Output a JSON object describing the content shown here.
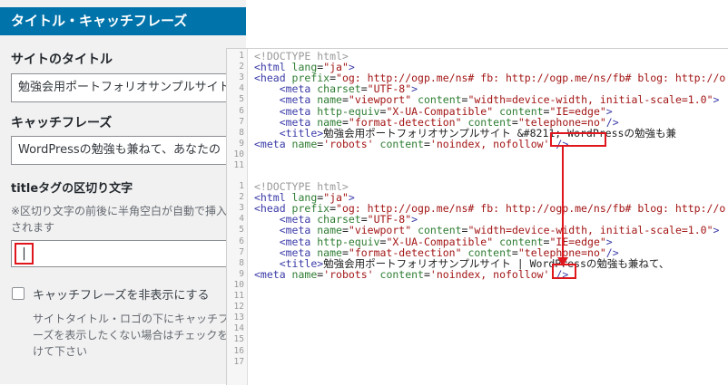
{
  "panel": {
    "header": "タイトル・キャッチフレーズ",
    "site_title_label": "サイトのタイトル",
    "site_title_value": "勉強会用ポートフォリオサンプルサイト",
    "catchphrase_label": "キャッチフレーズ",
    "catchphrase_value": "WordPressの勉強も兼ねて、あなたの",
    "separator_label": "titleタグの区切り文字",
    "separator_note": "※区切り文字の前後に半角空白が自動で挿入されます",
    "separator_value": "|",
    "hide_checkbox_label": "キャッチフレーズを非表示にする",
    "hide_note": "サイトタイトル・ロゴの下にキャッチフレーズを表示したくない場合はチェックを付けて下さい"
  },
  "code": {
    "block1": {
      "lines": [
        {
          "n": "1",
          "parts": [
            [
              "c",
              "<!DOCTYPE html>"
            ]
          ]
        },
        {
          "n": "2",
          "parts": [
            [
              "t",
              "<html "
            ],
            [
              "a",
              "lang"
            ],
            [
              "p",
              "="
            ],
            [
              "v",
              "\"ja\""
            ],
            [
              "t",
              ">"
            ]
          ]
        },
        {
          "n": "3",
          "parts": [
            [
              "t",
              "<head "
            ],
            [
              "a",
              "prefix"
            ],
            [
              "p",
              "="
            ],
            [
              "v",
              "\"og: http://ogp.me/ns# fb: http://ogp.me/ns/fb# blog: http://o"
            ]
          ]
        },
        {
          "n": "4",
          "parts": [
            [
              "p",
              "    "
            ],
            [
              "t",
              "<meta "
            ],
            [
              "a",
              "charset"
            ],
            [
              "p",
              "="
            ],
            [
              "v",
              "\"UTF-8\""
            ],
            [
              "t",
              ">"
            ]
          ]
        },
        {
          "n": "5",
          "parts": [
            [
              "p",
              "    "
            ],
            [
              "t",
              "<meta "
            ],
            [
              "a",
              "name"
            ],
            [
              "p",
              "="
            ],
            [
              "v",
              "\"viewport\""
            ],
            [
              "p",
              " "
            ],
            [
              "a",
              "content"
            ],
            [
              "p",
              "="
            ],
            [
              "v",
              "\"width=device-width, initial-scale=1.0\""
            ],
            [
              "t",
              ">"
            ]
          ]
        },
        {
          "n": "6",
          "parts": [
            [
              "p",
              "    "
            ],
            [
              "t",
              "<meta "
            ],
            [
              "a",
              "http-equiv"
            ],
            [
              "p",
              "="
            ],
            [
              "v",
              "\"X-UA-Compatible\""
            ],
            [
              "p",
              " "
            ],
            [
              "a",
              "content"
            ],
            [
              "p",
              "="
            ],
            [
              "v",
              "\"IE=edge\""
            ],
            [
              "t",
              ">"
            ]
          ]
        },
        {
          "n": "7",
          "parts": [
            [
              "p",
              "    "
            ],
            [
              "t",
              "<meta "
            ],
            [
              "a",
              "name"
            ],
            [
              "p",
              "="
            ],
            [
              "v",
              "\"format-detection\""
            ],
            [
              "p",
              " "
            ],
            [
              "a",
              "content"
            ],
            [
              "p",
              "="
            ],
            [
              "v",
              "\"telephone=no\""
            ],
            [
              "t",
              "/>"
            ]
          ]
        },
        {
          "n": "8",
          "parts": [
            [
              "p",
              "    "
            ],
            [
              "t",
              "<title>"
            ],
            [
              "p",
              "勉強会用ポートフォリオサンプルサイト "
            ],
            [
              "p",
              "&#8211;"
            ],
            [
              "p",
              " WordPressの勉強も兼"
            ]
          ]
        },
        {
          "n": "9",
          "parts": [
            [
              "t",
              "<meta "
            ],
            [
              "a",
              "name"
            ],
            [
              "p",
              "="
            ],
            [
              "v",
              "'robots'"
            ],
            [
              "p",
              " "
            ],
            [
              "a",
              "content"
            ],
            [
              "p",
              "="
            ],
            [
              "v",
              "'noindex, nofollow'"
            ],
            [
              "p",
              " "
            ],
            [
              "t",
              "/>"
            ]
          ]
        },
        {
          "n": "10",
          "parts": []
        },
        {
          "n": "11",
          "parts": []
        }
      ]
    },
    "block2": {
      "lines": [
        {
          "n": "1",
          "parts": [
            [
              "c",
              "<!DOCTYPE html>"
            ]
          ]
        },
        {
          "n": "2",
          "parts": [
            [
              "t",
              "<html "
            ],
            [
              "a",
              "lang"
            ],
            [
              "p",
              "="
            ],
            [
              "v",
              "\"ja\""
            ],
            [
              "t",
              ">"
            ]
          ]
        },
        {
          "n": "3",
          "parts": [
            [
              "t",
              "<head "
            ],
            [
              "a",
              "prefix"
            ],
            [
              "p",
              "="
            ],
            [
              "v",
              "\"og: http://ogp.me/ns# fb: http://ogp.me/ns/fb# blog: http://o"
            ]
          ]
        },
        {
          "n": "4",
          "parts": [
            [
              "p",
              "    "
            ],
            [
              "t",
              "<meta "
            ],
            [
              "a",
              "charset"
            ],
            [
              "p",
              "="
            ],
            [
              "v",
              "\"UTF-8\""
            ],
            [
              "t",
              ">"
            ]
          ]
        },
        {
          "n": "5",
          "parts": [
            [
              "p",
              "    "
            ],
            [
              "t",
              "<meta "
            ],
            [
              "a",
              "name"
            ],
            [
              "p",
              "="
            ],
            [
              "v",
              "\"viewport\""
            ],
            [
              "p",
              " "
            ],
            [
              "a",
              "content"
            ],
            [
              "p",
              "="
            ],
            [
              "v",
              "\"width=device-width, initial-scale=1.0\""
            ],
            [
              "t",
              ">"
            ]
          ]
        },
        {
          "n": "6",
          "parts": [
            [
              "p",
              "    "
            ],
            [
              "t",
              "<meta "
            ],
            [
              "a",
              "http-equiv"
            ],
            [
              "p",
              "="
            ],
            [
              "v",
              "\"X-UA-Compatible\""
            ],
            [
              "p",
              " "
            ],
            [
              "a",
              "content"
            ],
            [
              "p",
              "="
            ],
            [
              "v",
              "\"IE=edge\""
            ],
            [
              "t",
              ">"
            ]
          ]
        },
        {
          "n": "7",
          "parts": [
            [
              "p",
              "    "
            ],
            [
              "t",
              "<meta "
            ],
            [
              "a",
              "name"
            ],
            [
              "p",
              "="
            ],
            [
              "v",
              "\"format-detection\""
            ],
            [
              "p",
              " "
            ],
            [
              "a",
              "content"
            ],
            [
              "p",
              "="
            ],
            [
              "v",
              "\"telephone=no\""
            ],
            [
              "t",
              "/>"
            ]
          ]
        },
        {
          "n": "8",
          "parts": [
            [
              "p",
              "    "
            ],
            [
              "t",
              "<title>"
            ],
            [
              "p",
              "勉強会用ポートフォリオサンプルサイト "
            ],
            [
              "p",
              "|"
            ],
            [
              "p",
              " WordPressの勉強も兼ねて、"
            ]
          ]
        },
        {
          "n": "9",
          "parts": [
            [
              "t",
              "<meta "
            ],
            [
              "a",
              "name"
            ],
            [
              "p",
              "="
            ],
            [
              "v",
              "'robots'"
            ],
            [
              "p",
              " "
            ],
            [
              "a",
              "content"
            ],
            [
              "p",
              "="
            ],
            [
              "v",
              "'noindex, nofollow'"
            ],
            [
              "p",
              " "
            ],
            [
              "t",
              "/>"
            ]
          ]
        },
        {
          "n": "10",
          "parts": []
        },
        {
          "n": "11",
          "parts": []
        },
        {
          "n": "12",
          "parts": []
        },
        {
          "n": "13",
          "parts": []
        },
        {
          "n": "14",
          "parts": []
        },
        {
          "n": "15",
          "parts": []
        },
        {
          "n": "16",
          "parts": []
        },
        {
          "n": "17",
          "parts": []
        }
      ]
    }
  },
  "colors": {
    "header_bg": "#0073aa",
    "highlight": "#e0161d"
  }
}
